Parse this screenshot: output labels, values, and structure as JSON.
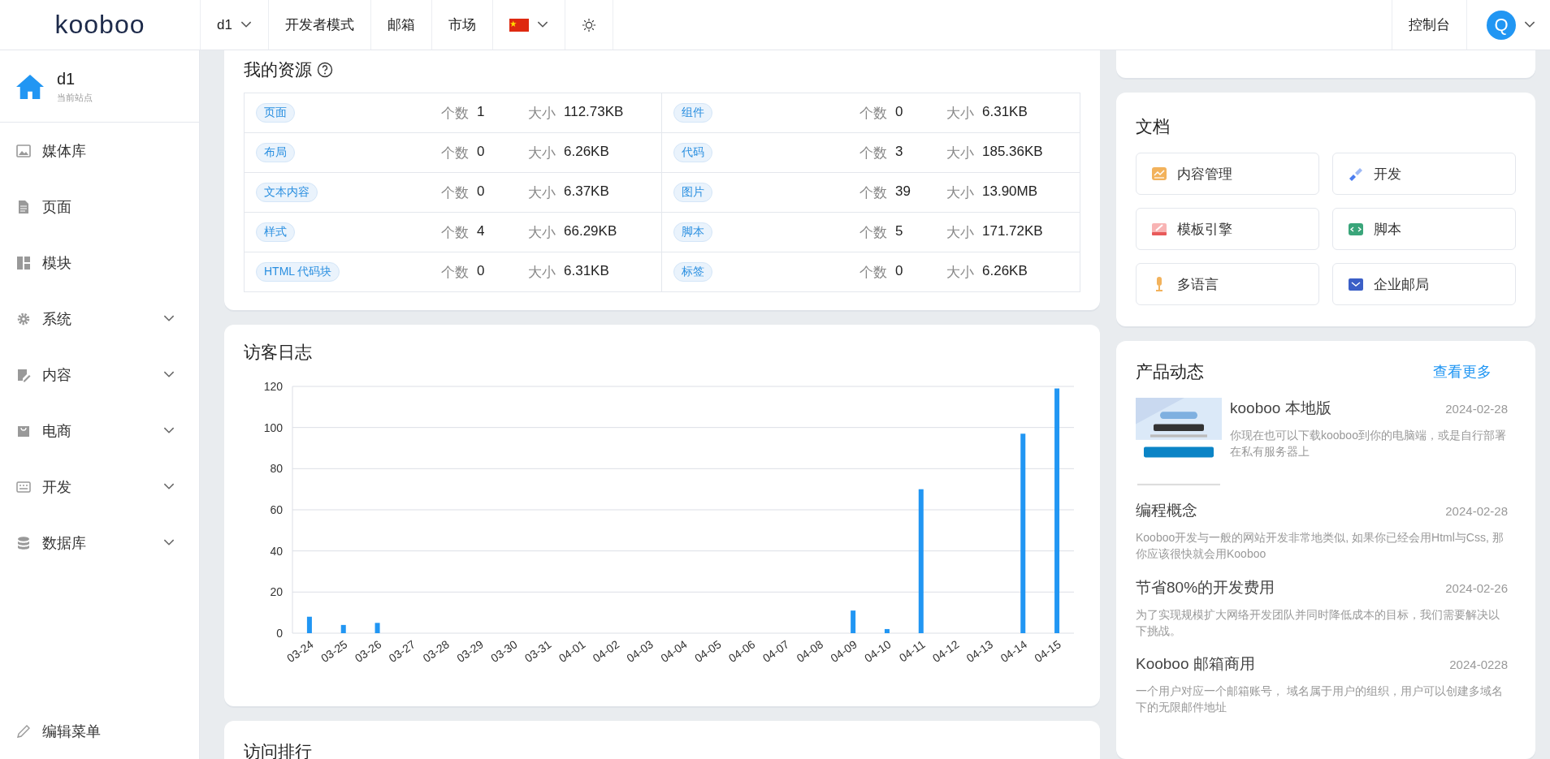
{
  "header": {
    "logo": "kooboo",
    "site": "d1",
    "nav": [
      "开发者模式",
      "邮箱",
      "市场"
    ],
    "console": "控制台",
    "avatar": "Q"
  },
  "sidebar": {
    "site": {
      "name": "d1",
      "caption": "当前站点"
    },
    "items": [
      {
        "label": "媒体库",
        "kind": "link"
      },
      {
        "label": "页面",
        "kind": "link"
      },
      {
        "label": "模块",
        "kind": "link"
      },
      {
        "label": "系统",
        "kind": "group",
        "expanded": false
      },
      {
        "label": "内容",
        "kind": "group",
        "expanded": false
      },
      {
        "label": "电商",
        "kind": "group",
        "expanded": false
      },
      {
        "label": "开发",
        "kind": "group",
        "expanded": false
      },
      {
        "label": "数据库",
        "kind": "group",
        "expanded": false
      }
    ],
    "edit_menu": "编辑菜单"
  },
  "resources": {
    "title": "我的资源",
    "cells": [
      {
        "tag": "页面",
        "count_label": "个数",
        "count": "1",
        "size_label": "大小",
        "size": "112.73KB"
      },
      {
        "tag": "组件",
        "count_label": "个数",
        "count": "0",
        "size_label": "大小",
        "size": "6.31KB"
      },
      {
        "tag": "布局",
        "count_label": "个数",
        "count": "0",
        "size_label": "大小",
        "size": "6.26KB"
      },
      {
        "tag": "代码",
        "count_label": "个数",
        "count": "3",
        "size_label": "大小",
        "size": "185.36KB"
      },
      {
        "tag": "文本内容",
        "count_label": "个数",
        "count": "0",
        "size_label": "大小",
        "size": "6.37KB"
      },
      {
        "tag": "图片",
        "count_label": "个数",
        "count": "39",
        "size_label": "大小",
        "size": "13.90MB"
      },
      {
        "tag": "样式",
        "count_label": "个数",
        "count": "4",
        "size_label": "大小",
        "size": "66.29KB"
      },
      {
        "tag": "脚本",
        "count_label": "个数",
        "count": "5",
        "size_label": "大小",
        "size": "171.72KB"
      },
      {
        "tag": "HTML 代码块",
        "count_label": "个数",
        "count": "0",
        "size_label": "大小",
        "size": "6.31KB"
      },
      {
        "tag": "标签",
        "count_label": "个数",
        "count": "0",
        "size_label": "大小",
        "size": "6.26KB"
      }
    ]
  },
  "visitor_log": {
    "title": "访客日志",
    "chart_data": {
      "type": "bar",
      "categories": [
        "03-24",
        "03-25",
        "03-26",
        "03-27",
        "03-28",
        "03-29",
        "03-30",
        "03-31",
        "04-01",
        "04-02",
        "04-03",
        "04-04",
        "04-05",
        "04-06",
        "04-07",
        "04-08",
        "04-09",
        "04-10",
        "04-11",
        "04-12",
        "04-13",
        "04-14",
        "04-15"
      ],
      "series": [
        {
          "color": "#2196f3",
          "values": [
            8,
            4,
            5,
            0,
            0,
            0,
            0,
            0,
            0,
            0,
            0,
            0,
            0,
            0,
            0,
            0,
            11,
            2,
            70,
            0,
            0,
            97,
            119
          ]
        }
      ],
      "grid": true,
      "ylim": [
        0,
        120
      ],
      "yticks": [
        0,
        20,
        40,
        60,
        80,
        100,
        120
      ]
    }
  },
  "ranking": {
    "title": "访问排行"
  },
  "docs": {
    "title": "文档",
    "items": [
      {
        "label": "内容管理",
        "kind": "chart"
      },
      {
        "label": "开发",
        "kind": "plug"
      },
      {
        "label": "模板引擎",
        "kind": "template"
      },
      {
        "label": "脚本",
        "kind": "code"
      },
      {
        "label": "多语言",
        "kind": "mic"
      },
      {
        "label": "企业邮局",
        "kind": "mail"
      }
    ]
  },
  "news": {
    "title": "产品动态",
    "more": "查看更多",
    "items": [
      {
        "title": "kooboo 本地版",
        "date": "2024-02-28",
        "text": "你现在也可以下载kooboo到你的电脑端，或是自行部署在私有服务器上",
        "kind": "picture"
      },
      {
        "title": "编程概念",
        "date": "2024-02-28",
        "text": "Kooboo开发与一般的网站开发非常地类似, 如果你已经会用Html与Css, 那你应该很快就会用Kooboo",
        "kind": "text"
      },
      {
        "title": "节省80%的开发费用",
        "date": "2024-02-26",
        "text": "为了实现规模扩大网络开发团队并同时降低成本的目标，我们需要解决以下挑战。",
        "kind": "text"
      },
      {
        "title": "Kooboo 邮箱商用",
        "date": "2024-0228",
        "text": "一个用户对应一个邮箱账号， 域名属于用户的组织，用户可以创建多域名下的无限邮件地址",
        "kind": "text"
      }
    ]
  }
}
